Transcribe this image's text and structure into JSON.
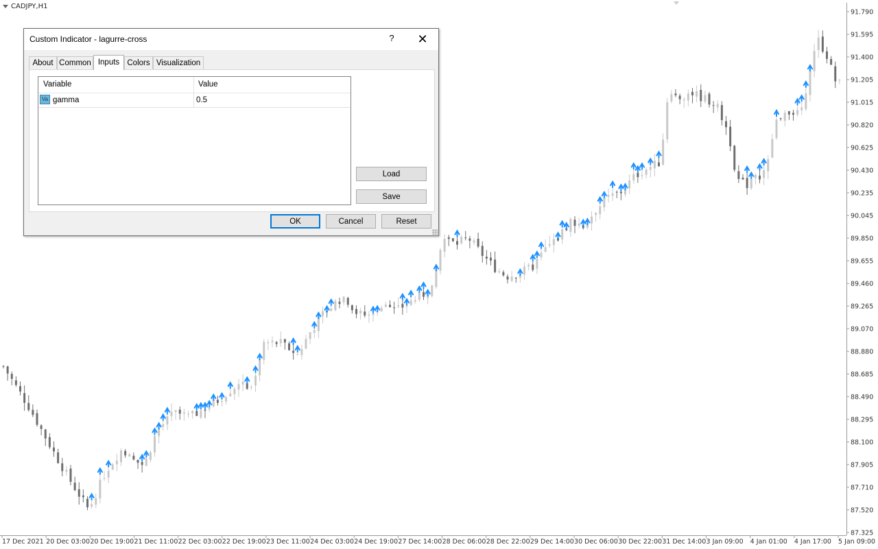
{
  "chart": {
    "symbol": "CADJPY,H1",
    "y_labels": [
      "91.790",
      "91.595",
      "91.400",
      "91.205",
      "91.015",
      "90.820",
      "90.625",
      "90.430",
      "90.235",
      "90.045",
      "89.850",
      "89.655",
      "89.460",
      "89.265",
      "89.070",
      "88.880",
      "88.685",
      "88.490",
      "88.295",
      "88.100",
      "87.905",
      "87.710",
      "87.520",
      "87.325"
    ],
    "x_labels": [
      "17 Dec 2021",
      "20 Dec 03:00",
      "20 Dec 19:00",
      "21 Dec 11:00",
      "22 Dec 03:00",
      "22 Dec 19:00",
      "23 Dec 11:00",
      "24 Dec 03:00",
      "24 Dec 19:00",
      "27 Dec 14:00",
      "28 Dec 06:00",
      "28 Dec 22:00",
      "29 Dec 14:00",
      "30 Dec 06:00",
      "30 Dec 22:00",
      "31 Dec 14:00",
      "3 Jan 09:00",
      "4 Jan 01:00",
      "4 Jan 17:00",
      "5 Jan 09:00"
    ],
    "colors": {
      "bull": "#c8c8c8",
      "bear": "#6e6e6e",
      "signal_arrow": "#1e90ff",
      "axis": "#999999"
    }
  },
  "chart_data": {
    "type": "candlestick",
    "y_range": [
      87.325,
      91.79
    ],
    "close_path": [
      [
        0,
        88.75
      ],
      [
        6,
        88.4
      ],
      [
        12,
        88.0
      ],
      [
        16,
        87.75
      ],
      [
        20,
        87.52
      ],
      [
        24,
        87.85
      ],
      [
        28,
        88.05
      ],
      [
        30,
        87.95
      ],
      [
        33,
        87.9
      ],
      [
        36,
        88.2
      ],
      [
        40,
        88.35
      ],
      [
        44,
        88.32
      ],
      [
        50,
        88.45
      ],
      [
        55,
        88.6
      ],
      [
        58,
        88.55
      ],
      [
        61,
        88.95
      ],
      [
        65,
        88.95
      ],
      [
        69,
        88.85
      ],
      [
        72,
        89.05
      ],
      [
        75,
        89.2
      ],
      [
        78,
        89.3
      ],
      [
        80,
        89.35
      ],
      [
        83,
        89.2
      ],
      [
        86,
        89.18
      ],
      [
        89,
        89.3
      ],
      [
        92,
        89.22
      ],
      [
        95,
        89.3
      ],
      [
        98,
        89.35
      ],
      [
        101,
        89.45
      ],
      [
        103,
        89.85
      ],
      [
        106,
        89.8
      ],
      [
        109,
        89.85
      ],
      [
        112,
        89.72
      ],
      [
        115,
        89.6
      ],
      [
        118,
        89.52
      ],
      [
        121,
        89.55
      ],
      [
        124,
        89.6
      ],
      [
        127,
        89.75
      ],
      [
        130,
        89.85
      ],
      [
        133,
        90.0
      ],
      [
        136,
        89.95
      ],
      [
        139,
        90.1
      ],
      [
        142,
        90.2
      ],
      [
        145,
        90.25
      ],
      [
        148,
        90.38
      ],
      [
        151,
        90.45
      ],
      [
        154,
        90.5
      ],
      [
        156,
        91.15
      ],
      [
        158,
        91.05
      ],
      [
        161,
        91.1
      ],
      [
        164,
        91.05
      ],
      [
        167,
        91.0
      ],
      [
        170,
        90.75
      ],
      [
        172,
        90.35
      ],
      [
        174,
        90.3
      ],
      [
        177,
        90.38
      ],
      [
        179,
        90.45
      ],
      [
        181,
        90.85
      ],
      [
        184,
        90.95
      ],
      [
        187,
        90.9
      ],
      [
        189,
        91.3
      ],
      [
        191,
        91.55
      ],
      [
        193,
        91.42
      ],
      [
        195,
        91.2
      ],
      [
        197,
        91.15
      ]
    ],
    "signal_arrows": "blue up-arrows above highs during bullish runs"
  },
  "dialog": {
    "title": "Custom Indicator - lagurre-cross",
    "help": "?",
    "close": "✕",
    "tabs": [
      "About",
      "Common",
      "Inputs",
      "Colors",
      "Visualization"
    ],
    "active_tab": "Inputs",
    "grid": {
      "headers": [
        "Variable",
        "Value"
      ],
      "rows": [
        {
          "icon": "Va",
          "variable": "gamma",
          "value": "0.5"
        }
      ]
    },
    "buttons": {
      "load": "Load",
      "save": "Save",
      "ok": "OK",
      "cancel": "Cancel",
      "reset": "Reset"
    }
  }
}
